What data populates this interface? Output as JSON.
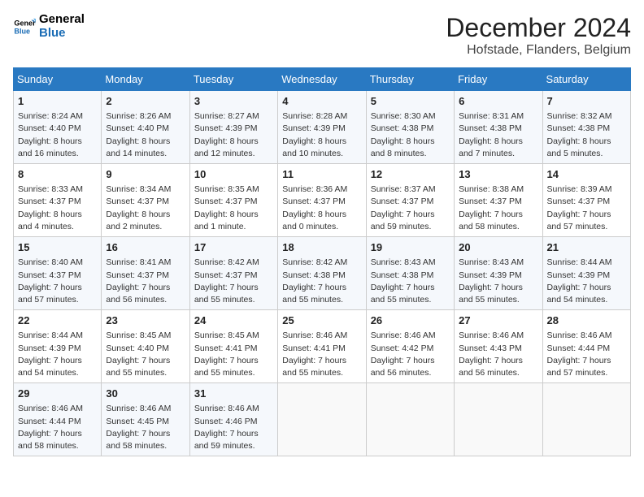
{
  "logo": {
    "line1": "General",
    "line2": "Blue"
  },
  "title": "December 2024",
  "location": "Hofstade, Flanders, Belgium",
  "days_of_week": [
    "Sunday",
    "Monday",
    "Tuesday",
    "Wednesday",
    "Thursday",
    "Friday",
    "Saturday"
  ],
  "weeks": [
    [
      {
        "day": "1",
        "sunrise": "8:24 AM",
        "sunset": "4:40 PM",
        "daylight": "8 hours and 16 minutes."
      },
      {
        "day": "2",
        "sunrise": "8:26 AM",
        "sunset": "4:40 PM",
        "daylight": "8 hours and 14 minutes."
      },
      {
        "day": "3",
        "sunrise": "8:27 AM",
        "sunset": "4:39 PM",
        "daylight": "8 hours and 12 minutes."
      },
      {
        "day": "4",
        "sunrise": "8:28 AM",
        "sunset": "4:39 PM",
        "daylight": "8 hours and 10 minutes."
      },
      {
        "day": "5",
        "sunrise": "8:30 AM",
        "sunset": "4:38 PM",
        "daylight": "8 hours and 8 minutes."
      },
      {
        "day": "6",
        "sunrise": "8:31 AM",
        "sunset": "4:38 PM",
        "daylight": "8 hours and 7 minutes."
      },
      {
        "day": "7",
        "sunrise": "8:32 AM",
        "sunset": "4:38 PM",
        "daylight": "8 hours and 5 minutes."
      }
    ],
    [
      {
        "day": "8",
        "sunrise": "8:33 AM",
        "sunset": "4:37 PM",
        "daylight": "8 hours and 4 minutes."
      },
      {
        "day": "9",
        "sunrise": "8:34 AM",
        "sunset": "4:37 PM",
        "daylight": "8 hours and 2 minutes."
      },
      {
        "day": "10",
        "sunrise": "8:35 AM",
        "sunset": "4:37 PM",
        "daylight": "8 hours and 1 minute."
      },
      {
        "day": "11",
        "sunrise": "8:36 AM",
        "sunset": "4:37 PM",
        "daylight": "8 hours and 0 minutes."
      },
      {
        "day": "12",
        "sunrise": "8:37 AM",
        "sunset": "4:37 PM",
        "daylight": "7 hours and 59 minutes."
      },
      {
        "day": "13",
        "sunrise": "8:38 AM",
        "sunset": "4:37 PM",
        "daylight": "7 hours and 58 minutes."
      },
      {
        "day": "14",
        "sunrise": "8:39 AM",
        "sunset": "4:37 PM",
        "daylight": "7 hours and 57 minutes."
      }
    ],
    [
      {
        "day": "15",
        "sunrise": "8:40 AM",
        "sunset": "4:37 PM",
        "daylight": "7 hours and 57 minutes."
      },
      {
        "day": "16",
        "sunrise": "8:41 AM",
        "sunset": "4:37 PM",
        "daylight": "7 hours and 56 minutes."
      },
      {
        "day": "17",
        "sunrise": "8:42 AM",
        "sunset": "4:37 PM",
        "daylight": "7 hours and 55 minutes."
      },
      {
        "day": "18",
        "sunrise": "8:42 AM",
        "sunset": "4:38 PM",
        "daylight": "7 hours and 55 minutes."
      },
      {
        "day": "19",
        "sunrise": "8:43 AM",
        "sunset": "4:38 PM",
        "daylight": "7 hours and 55 minutes."
      },
      {
        "day": "20",
        "sunrise": "8:43 AM",
        "sunset": "4:39 PM",
        "daylight": "7 hours and 55 minutes."
      },
      {
        "day": "21",
        "sunrise": "8:44 AM",
        "sunset": "4:39 PM",
        "daylight": "7 hours and 54 minutes."
      }
    ],
    [
      {
        "day": "22",
        "sunrise": "8:44 AM",
        "sunset": "4:39 PM",
        "daylight": "7 hours and 54 minutes."
      },
      {
        "day": "23",
        "sunrise": "8:45 AM",
        "sunset": "4:40 PM",
        "daylight": "7 hours and 55 minutes."
      },
      {
        "day": "24",
        "sunrise": "8:45 AM",
        "sunset": "4:41 PM",
        "daylight": "7 hours and 55 minutes."
      },
      {
        "day": "25",
        "sunrise": "8:46 AM",
        "sunset": "4:41 PM",
        "daylight": "7 hours and 55 minutes."
      },
      {
        "day": "26",
        "sunrise": "8:46 AM",
        "sunset": "4:42 PM",
        "daylight": "7 hours and 56 minutes."
      },
      {
        "day": "27",
        "sunrise": "8:46 AM",
        "sunset": "4:43 PM",
        "daylight": "7 hours and 56 minutes."
      },
      {
        "day": "28",
        "sunrise": "8:46 AM",
        "sunset": "4:44 PM",
        "daylight": "7 hours and 57 minutes."
      }
    ],
    [
      {
        "day": "29",
        "sunrise": "8:46 AM",
        "sunset": "4:44 PM",
        "daylight": "7 hours and 58 minutes."
      },
      {
        "day": "30",
        "sunrise": "8:46 AM",
        "sunset": "4:45 PM",
        "daylight": "7 hours and 58 minutes."
      },
      {
        "day": "31",
        "sunrise": "8:46 AM",
        "sunset": "4:46 PM",
        "daylight": "7 hours and 59 minutes."
      },
      null,
      null,
      null,
      null
    ]
  ]
}
